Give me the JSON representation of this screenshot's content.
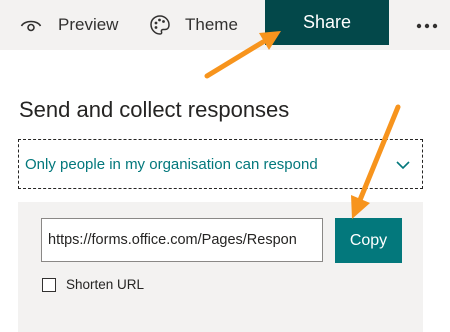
{
  "toolbar": {
    "preview_label": "Preview",
    "theme_label": "Theme",
    "share_label": "Share",
    "more_icon": "more-dots-icon"
  },
  "share_panel": {
    "title": "Send and collect responses",
    "permission_dropdown": {
      "selected": "Only people in my organisation can respond"
    },
    "link": {
      "value": "https://forms.office.com/Pages/Respon",
      "copy_label": "Copy"
    },
    "shorten_url": {
      "label": "Shorten URL",
      "checked": false
    }
  },
  "colors": {
    "share_tab_bg": "#03484a",
    "accent": "#03787c",
    "annotation_arrow": "#f7941d",
    "toolbar_bg": "#f3f2f1"
  }
}
